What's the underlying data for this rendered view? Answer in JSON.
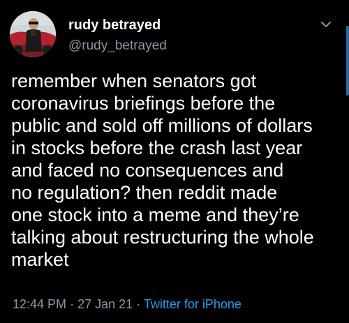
{
  "user": {
    "display_name": "rudy betrayed",
    "handle": "@rudy_betrayed"
  },
  "tweet": {
    "text": "remember when senators got\ncoronavirus briefings before the\npublic and sold off millions of dollars\nin stocks before the crash last year\nand faced no consequences and\nno regulation? then reddit made\none stock into a meme and they’re\ntalking about restructuring the whole\nmarket",
    "time": "12:44 PM",
    "date": "27 Jan 21",
    "separator": "·",
    "source": "Twitter for iPhone"
  },
  "icons": {
    "menu": "chevron-down-icon"
  },
  "colors": {
    "background": "#000000",
    "text": "#ffffff",
    "secondary": "#8b98a5",
    "link": "#1da1f2"
  }
}
